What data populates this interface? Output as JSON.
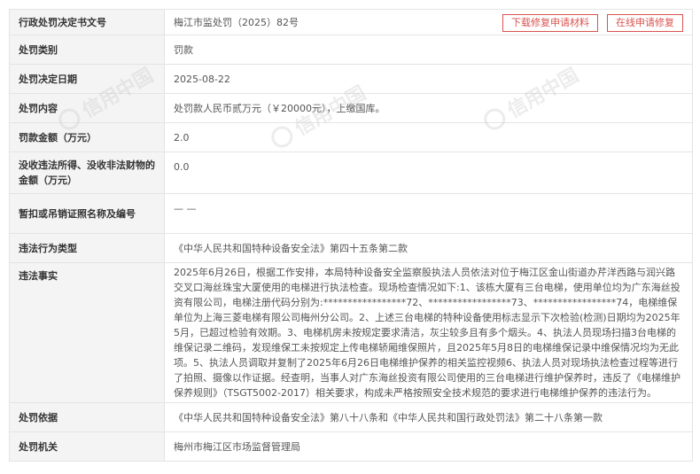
{
  "actions": {
    "download_label": "下载修复申请材料",
    "online_label": "在线申请修复"
  },
  "watermark": {
    "text": "信用中国"
  },
  "table": {
    "rows": [
      {
        "label": "行政处罚决定书文号",
        "value": "梅江市监处罚（2025）82号"
      },
      {
        "label": "处罚类别",
        "value": "罚款"
      },
      {
        "label": "处罚决定日期",
        "value": "2025-08-22"
      },
      {
        "label": "处罚内容",
        "value": "处罚款人民币贰万元（￥20000元），上缴国库。"
      },
      {
        "label": "罚款金额（万元）",
        "value": "2.0"
      },
      {
        "label": "没收违法所得、没收非法财物的金额（万元）",
        "value": "0.0"
      },
      {
        "label": "暂扣或吊销证照名称及编号",
        "value": "— —"
      },
      {
        "label": "违法行为类型",
        "value": "《中华人民共和国特种设备安全法》第四十五条第二款"
      },
      {
        "label": "违法事实",
        "value": "2025年6月26日，根据工作安排，本局特种设备安全监察股执法人员依法对位于梅江区金山街道办芹洋西路与润兴路交叉口海丝珠宝大厦使用的电梯进行执法检查。现场检查情况如下:1、该栋大厦有三台电梯，使用单位均为广东海丝投资有限公司，电梯注册代码分别为:*****************72、*****************73、*****************74，电梯维保单位为上海三菱电梯有限公司梅州分公司。2、上述三台电梯的特种设备使用标志显示下次检验(检测)日期均为2025年5月，已超过检验有效期。3、电梯机房未按规定要求清洁，灰尘较多且有多个烟头。4、执法人员现场扫描3台电梯的维保记录二维码，发现维保工未按规定上传电梯轿厢维保照片，且2025年5月8日的电梯维保记录中维保情况均为无此项。5、执法人员调取并复制了2025年6月26日电梯维护保养的相关监控视频6、执法人员对现场执法检查过程等进行了拍照、摄像以作证据。经查明，当事人对广东海丝投资有限公司使用的三台电梯进行维护保养时，违反了《电梯维护保养规则》（TSGT5002-2017）相关要求，构成未严格按照安全技术规范的要求进行电梯维护保养的违法行为。"
      },
      {
        "label": "处罚依据",
        "value": "《中华人民共和国特种设备安全法》第八十八条和《中华人民共和国行政处罚法》第二十八条第一款"
      },
      {
        "label": "处罚机关",
        "value": "梅州市梅江区市场监督管理局"
      }
    ]
  }
}
